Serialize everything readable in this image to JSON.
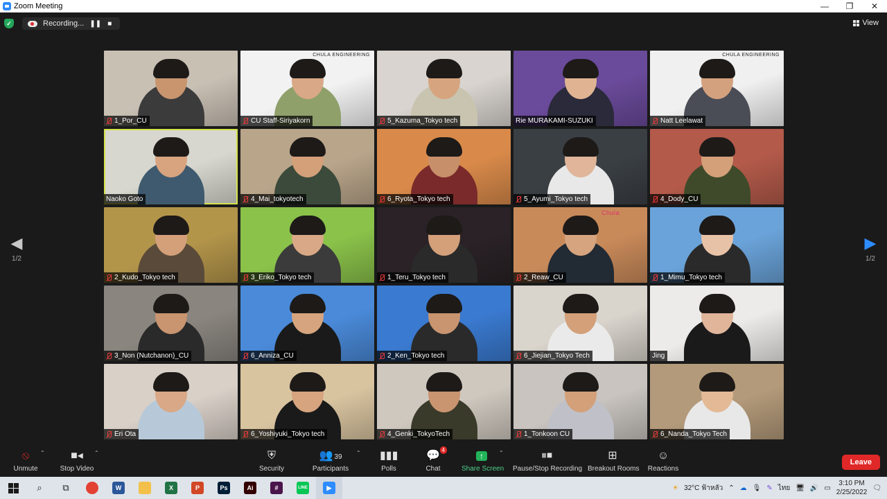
{
  "window": {
    "title": "Zoom Meeting",
    "minimize": "—",
    "maximize": "❐",
    "close": "✕"
  },
  "recording": {
    "label": "Recording...",
    "pause": "❚❚",
    "stop": "■"
  },
  "view": {
    "label": "View"
  },
  "pagination": {
    "left_page": "1/2",
    "right_page": "1/2"
  },
  "participants_grid": [
    {
      "name": "1_Por_CU",
      "muted": true,
      "bg": "#c9c0b4",
      "shirt": "#3b3b3b",
      "skin": "#c8956f"
    },
    {
      "name": "CU Staff-Siriyakorn",
      "muted": true,
      "bg": "#f2f2f2",
      "shirt": "#8fa06a",
      "skin": "#d9a886",
      "logo": "CHULA ENGINEERING"
    },
    {
      "name": "5_Kazuma_Tokyo tech",
      "muted": true,
      "bg": "#d9d4cf",
      "shirt": "#c9c4b0",
      "skin": "#d6a47e"
    },
    {
      "name": "Rie MURAKAMI-SUZUKI",
      "muted": false,
      "bg": "#6a4a9a",
      "shirt": "#2a2a3a",
      "skin": "#e0b392"
    },
    {
      "name": "Natt Leelawat",
      "muted": true,
      "bg": "#f0f0f0",
      "shirt": "#4a4d55",
      "skin": "#d4a17e",
      "logo": "CHULA ENGINEERING"
    },
    {
      "name": "Naoko Goto",
      "muted": false,
      "bg": "#d7d7cf",
      "shirt": "#3f5a6e",
      "skin": "#d8a47f",
      "active": true
    },
    {
      "name": "4_Mai_tokyotech",
      "muted": true,
      "bg": "#b9a58a",
      "shirt": "#3b4a3b",
      "skin": "#d3a07a"
    },
    {
      "name": "6_Ryota_Tokyo tech",
      "muted": true,
      "bg": "#d98a4a",
      "shirt": "#7a2a2a",
      "skin": "#c8906a"
    },
    {
      "name": "5_Ayumi_Tokyo tech",
      "muted": true,
      "bg": "#3a3f44",
      "shirt": "#e8e8e8",
      "skin": "#e0b59a"
    },
    {
      "name": "4_Dody_CU",
      "muted": true,
      "bg": "#b35a4a",
      "shirt": "#3f4a2a",
      "skin": "#d3a07a"
    },
    {
      "name": "2_Kudo_Tokyo tech",
      "muted": true,
      "bg": "#b3954a",
      "shirt": "#5a4a3a",
      "skin": "#d3a07a"
    },
    {
      "name": "3_Eriko_Tokyo tech",
      "muted": true,
      "bg": "#8ac24a",
      "shirt": "#3b3b3b",
      "skin": "#d9a886"
    },
    {
      "name": "1_Teru_Tokyo tech",
      "muted": true,
      "bg": "#2a2226",
      "shirt": "#2a2a2a",
      "skin": "#d3a07a"
    },
    {
      "name": "2_Reaw_CU",
      "muted": true,
      "bg": "#c98a5a",
      "shirt": "#222a33",
      "skin": "#d6a47e",
      "logo": "Chula"
    },
    {
      "name": "1_Mimu_Tokyo tech",
      "muted": true,
      "bg": "#6aa3d9",
      "shirt": "#2a2a2a",
      "skin": "#e8c2a6"
    },
    {
      "name": "3_Non (Nutchanon)_CU",
      "muted": true,
      "bg": "#8a857f",
      "shirt": "#2a2a2a",
      "skin": "#c99470"
    },
    {
      "name": "6_Anniza_CU",
      "muted": true,
      "bg": "#4a8ad9",
      "shirt": "#1a1a1a",
      "skin": "#d6a47e"
    },
    {
      "name": "2_Ken_Tokyo tech",
      "muted": true,
      "bg": "#3a7ad0",
      "shirt": "#2a2a2a",
      "skin": "#c99470"
    },
    {
      "name": "6_Jiejian_Tokyo Tech",
      "muted": true,
      "bg": "#d9d4cc",
      "shirt": "#eaeaea",
      "skin": "#d3a07a"
    },
    {
      "name": "Jing",
      "muted": false,
      "bg": "#ecebea",
      "shirt": "#1a1a1a",
      "skin": "#e0b59a"
    },
    {
      "name": "Eri Ota",
      "muted": true,
      "bg": "#d9d0c8",
      "shirt": "#b7c9d9",
      "skin": "#d9a886"
    },
    {
      "name": "6_Yoshiyuki_Tokyo tech",
      "muted": true,
      "bg": "#d9c4a0",
      "shirt": "#1a1a1a",
      "skin": "#d6a47e"
    },
    {
      "name": "4_Genki_TokyoTech",
      "muted": true,
      "bg": "#cfc8bf",
      "shirt": "#3a3a2a",
      "skin": "#c99470"
    },
    {
      "name": "1_Tonkoon CU",
      "muted": true,
      "bg": "#c9c4bf",
      "shirt": "#c0c0c8",
      "skin": "#d3a07a"
    },
    {
      "name": "6_Nanda_Tokyo Tech",
      "muted": true,
      "bg": "#b39a7a",
      "shirt": "#e8e8e8",
      "skin": "#e3b996"
    }
  ],
  "toolbar": {
    "unmute": "Unmute",
    "stop_video": "Stop Video",
    "security": "Security",
    "participants": "Participants",
    "participants_count": "39",
    "polls": "Polls",
    "chat": "Chat",
    "chat_badge": "4",
    "share_screen": "Share Screen",
    "pause_stop_recording": "Pause/Stop Recording",
    "breakout_rooms": "Breakout Rooms",
    "reactions": "Reactions",
    "leave": "Leave"
  },
  "taskbar": {
    "weather": "32°C ฟ้าหลัว",
    "language": "ไทย",
    "time": "3:10 PM",
    "date": "2/25/2022",
    "apps": [
      {
        "name": "chrome",
        "label": "",
        "color": "#e34133"
      },
      {
        "name": "word",
        "label": "W",
        "color": "#2b579a"
      },
      {
        "name": "explorer",
        "label": "",
        "color": "#f3c14b"
      },
      {
        "name": "excel",
        "label": "X",
        "color": "#217346"
      },
      {
        "name": "powerpoint",
        "label": "P",
        "color": "#d24726"
      },
      {
        "name": "photoshop",
        "label": "Ps",
        "color": "#001e36"
      },
      {
        "name": "illustrator",
        "label": "Ai",
        "color": "#330000"
      },
      {
        "name": "slack",
        "label": "#",
        "color": "#4a154b"
      },
      {
        "name": "line",
        "label": "LINE",
        "color": "#06c755"
      },
      {
        "name": "zoom",
        "label": "▶",
        "color": "#2d8cff"
      }
    ]
  }
}
